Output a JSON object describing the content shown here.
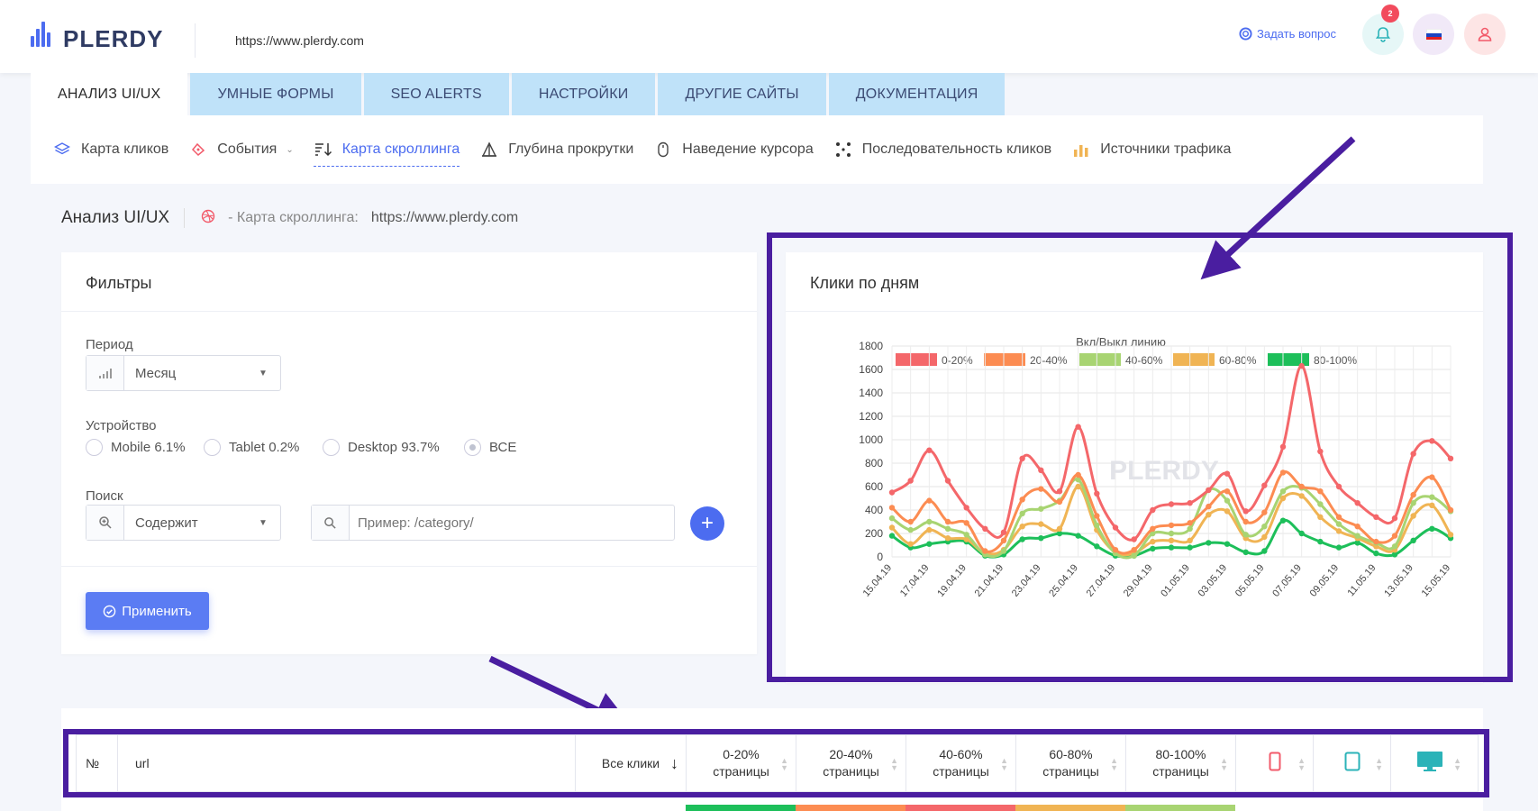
{
  "header": {
    "brand": "PLERDY",
    "site_url": "https://www.plerdy.com",
    "ask_label": "Задать вопрос",
    "notifications_count": "2"
  },
  "tabs": [
    "АНАЛИЗ UI/UX",
    "УМНЫЕ ФОРМЫ",
    "SEO ALERTS",
    "НАСТРОЙКИ",
    "ДРУГИЕ САЙТЫ",
    "ДОКУМЕНТАЦИЯ"
  ],
  "subnav": [
    "Карта кликов",
    "События",
    "Карта скроллинга",
    "Глубина прокрутки",
    "Наведение курсора",
    "Последовательность кликов",
    "Источники трафика"
  ],
  "breadcrumb": {
    "title": "Анализ UI/UX",
    "section": "- Карта скроллинга:",
    "url": "https://www.plerdy.com"
  },
  "filters": {
    "title": "Фильтры",
    "period_label": "Период",
    "period_value": "Месяц",
    "device_label": "Устройство",
    "devices": [
      "Mobile 6.1%",
      "Tablet 0.2%",
      "Desktop 93.7%",
      "ВСЕ"
    ],
    "search_label": "Поиск",
    "search_mode": "Содержит",
    "search_placeholder": "Пример: /category/",
    "apply_label": "Применить"
  },
  "chart_card_title": "Клики по дням",
  "chart_data": {
    "type": "line",
    "legend_title": "Вкл/Выкл линию",
    "legend_placement": "top",
    "ylim": [
      0,
      1800
    ],
    "yticks": [
      0,
      200,
      400,
      600,
      800,
      1000,
      1200,
      1400,
      1600,
      1800
    ],
    "grid": true,
    "x": [
      "15.04.19",
      "16.04.19",
      "17.04.19",
      "18.04.19",
      "19.04.19",
      "20.04.19",
      "21.04.19",
      "22.04.19",
      "23.04.19",
      "24.04.19",
      "25.04.19",
      "26.04.19",
      "27.04.19",
      "28.04.19",
      "29.04.19",
      "30.04.19",
      "01.05.19",
      "02.05.19",
      "03.05.19",
      "04.05.19",
      "05.05.19",
      "06.05.19",
      "07.05.19",
      "08.05.19",
      "09.05.19",
      "10.05.19",
      "11.05.19",
      "12.05.19",
      "13.05.19",
      "14.05.19",
      "15.05.19"
    ],
    "x_tick_labels": [
      "15.04.19",
      "17.04.19",
      "19.04.19",
      "21.04.19",
      "23.04.19",
      "25.04.19",
      "27.04.19",
      "29.04.19",
      "01.05.19",
      "03.05.19",
      "05.05.19",
      "07.05.19",
      "09.05.19",
      "11.05.19",
      "13.05.19",
      "15.05.19"
    ],
    "series": [
      {
        "name": "0-20%",
        "color": "#f4676a",
        "values": [
          550,
          650,
          910,
          650,
          420,
          240,
          210,
          840,
          740,
          560,
          1110,
          540,
          250,
          150,
          400,
          450,
          460,
          570,
          710,
          390,
          610,
          940,
          1630,
          900,
          600,
          460,
          340,
          330,
          880,
          990,
          840
        ]
      },
      {
        "name": "20-40%",
        "color": "#fc8c52",
        "values": [
          420,
          300,
          480,
          300,
          290,
          50,
          140,
          490,
          580,
          470,
          700,
          350,
          60,
          60,
          240,
          270,
          290,
          430,
          560,
          300,
          380,
          720,
          600,
          560,
          340,
          260,
          130,
          180,
          530,
          680,
          400
        ]
      },
      {
        "name": "40-60%",
        "color": "#a8d472",
        "values": [
          330,
          230,
          300,
          240,
          190,
          20,
          50,
          370,
          410,
          480,
          660,
          270,
          30,
          10,
          200,
          200,
          240,
          570,
          480,
          190,
          260,
          560,
          590,
          450,
          280,
          180,
          120,
          90,
          460,
          510,
          390
        ]
      },
      {
        "name": "60-80%",
        "color": "#f0b454",
        "values": [
          250,
          110,
          230,
          160,
          150,
          30,
          60,
          260,
          280,
          240,
          600,
          230,
          40,
          30,
          130,
          140,
          140,
          360,
          390,
          160,
          170,
          500,
          520,
          340,
          220,
          160,
          90,
          60,
          350,
          440,
          190
        ]
      },
      {
        "name": "80-100%",
        "color": "#1dbf5a",
        "values": [
          180,
          80,
          110,
          130,
          130,
          10,
          20,
          150,
          160,
          200,
          180,
          90,
          10,
          10,
          70,
          80,
          80,
          120,
          110,
          40,
          50,
          310,
          200,
          130,
          80,
          120,
          30,
          20,
          140,
          240,
          160
        ]
      }
    ]
  },
  "table": {
    "headers": [
      "№",
      "url",
      "Все клики",
      "0-20%\nстраницы",
      "20-40%\nстраницы",
      "40-60%\nстраницы",
      "60-80%\nстраницы",
      "80-100%\nстраницы"
    ]
  },
  "colors": {
    "accent": "#4c6cf0",
    "annotation": "#4a1ea0",
    "tab_inactive": "#bfe2f9"
  }
}
